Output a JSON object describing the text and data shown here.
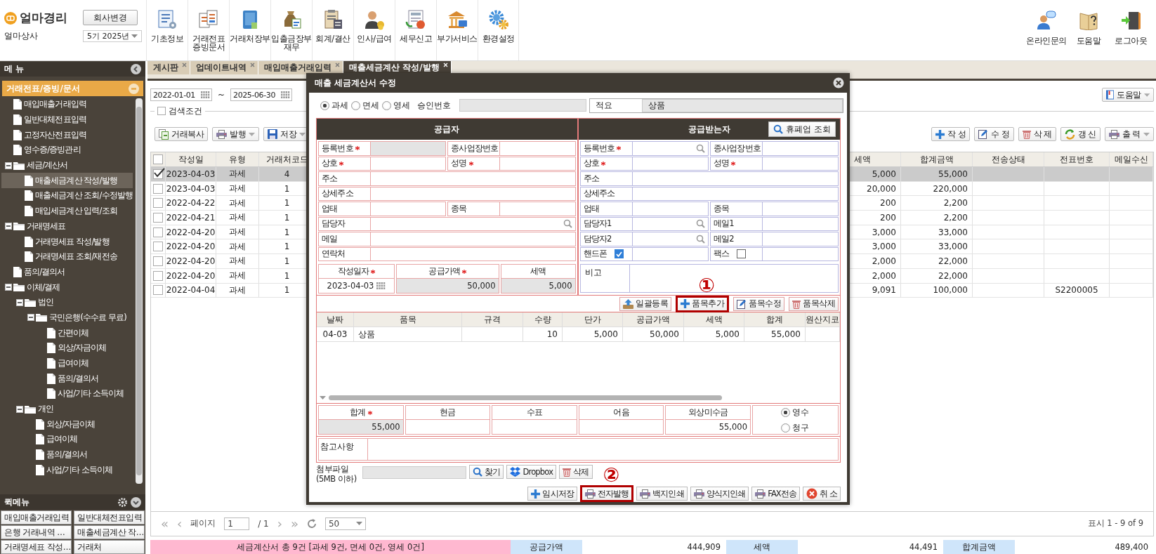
{
  "app": {
    "logo": "얼마경리",
    "company": "얼마상사",
    "change_company": "회사변경",
    "period": "5기 2025년"
  },
  "nav": [
    {
      "label": "기초정보"
    },
    {
      "label": "거래전표\n증빙문서"
    },
    {
      "label": "거래처장부"
    },
    {
      "label": "입출금장부\n재무"
    },
    {
      "label": "회계/결산"
    },
    {
      "label": "인사/급여"
    },
    {
      "label": "세무신고"
    },
    {
      "label": "부가서비스"
    },
    {
      "label": "환경설정"
    }
  ],
  "top_right": [
    {
      "label": "온라인문의"
    },
    {
      "label": "도움말"
    },
    {
      "label": "로그아웃"
    }
  ],
  "sidebar": {
    "title": "메 뉴",
    "group": "거래전표/증빙/문서",
    "tree": [
      {
        "label": "매입매출거래입력",
        "kind": "doc",
        "selected": false
      },
      {
        "label": "일반대체전표입력",
        "kind": "doc",
        "selected": false
      },
      {
        "label": "고정자산전표입력",
        "kind": "doc",
        "selected": false
      },
      {
        "label": "영수증/증빙관리",
        "kind": "doc",
        "selected": false
      },
      {
        "label": "세금/계산서",
        "kind": "folder",
        "expanded": true,
        "selected": false,
        "children": [
          {
            "label": "매출세금계산 작성/발행",
            "kind": "doc",
            "selected": true
          },
          {
            "label": "매출세금계산 조회/수정발행",
            "kind": "doc",
            "selected": false
          },
          {
            "label": "매입세금계산 입력/조회",
            "kind": "doc",
            "selected": false
          }
        ]
      },
      {
        "label": "거래명세표",
        "kind": "folder",
        "expanded": true,
        "selected": false,
        "children": [
          {
            "label": "거래명세표 작성/발행",
            "kind": "doc",
            "selected": false
          },
          {
            "label": "거래명세표 조회/재전송",
            "kind": "doc",
            "selected": false
          }
        ]
      },
      {
        "label": "품의/결의서",
        "kind": "doc",
        "selected": false
      },
      {
        "label": "이체/결제",
        "kind": "folder",
        "expanded": true,
        "selected": false,
        "children": [
          {
            "label": "법인",
            "kind": "folder",
            "expanded": true,
            "selected": false,
            "children": [
              {
                "label": "국민은행(수수료 무료)",
                "kind": "folder",
                "expanded": true,
                "selected": false,
                "children": [
                  {
                    "label": "간편이체",
                    "kind": "doc",
                    "selected": false
                  },
                  {
                    "label": "외상/자금이체",
                    "kind": "doc",
                    "selected": false
                  },
                  {
                    "label": "급여이체",
                    "kind": "doc",
                    "selected": false
                  },
                  {
                    "label": "품의/결의서",
                    "kind": "doc",
                    "selected": false
                  },
                  {
                    "label": "사업/기타 소득이체",
                    "kind": "doc",
                    "selected": false
                  }
                ]
              }
            ]
          },
          {
            "label": "개인",
            "kind": "folder",
            "expanded": true,
            "selected": false,
            "children": [
              {
                "label": "외상/자금이체",
                "kind": "doc",
                "selected": false
              },
              {
                "label": "급여이체",
                "kind": "doc",
                "selected": false
              },
              {
                "label": "품의/결의서",
                "kind": "doc",
                "selected": false
              },
              {
                "label": "사업/기타 소득이체",
                "kind": "doc",
                "selected": false
              }
            ]
          }
        ]
      }
    ]
  },
  "quick_menu": {
    "title": "퀵메뉴",
    "items": [
      "매입매출거래입력",
      "일반대체전표입력",
      "은행 거래내역 …",
      "매출세금계산 작…",
      "거래명세표 작성…",
      "거래처"
    ]
  },
  "tabs": [
    {
      "label": "게시판",
      "selected": false
    },
    {
      "label": "업데이트내역",
      "selected": false
    },
    {
      "label": "매입매출거래입력",
      "selected": false
    },
    {
      "label": "매출세금계산 작성/발행",
      "selected": true
    }
  ],
  "filter": {
    "date_from": "2022-01-01",
    "separator": "~",
    "date_to": "2025-06-30",
    "search_label": "검색조건",
    "search_checked": false,
    "help": "도움말"
  },
  "toolbar_left": [
    {
      "label": "거래복사",
      "kind": "copy",
      "dropdown": false
    },
    {
      "label": "발행",
      "kind": "print",
      "dropdown": true
    },
    {
      "label": "저장",
      "kind": "save",
      "dropdown": true
    }
  ],
  "toolbar_right": [
    {
      "label": "작 성",
      "kind": "add",
      "dropdown": false
    },
    {
      "label": "수 정",
      "kind": "edit",
      "dropdown": false
    },
    {
      "label": "삭 제",
      "kind": "delete",
      "dropdown": false
    },
    {
      "label": "갱 신",
      "kind": "refresh",
      "dropdown": false
    },
    {
      "label": "출 력",
      "kind": "print",
      "dropdown": true
    }
  ],
  "table": {
    "select_all": false,
    "columns": [
      "작성일",
      "유형",
      "거래처코드",
      "세액",
      "합계금액",
      "전송상태",
      "전표번호",
      "메일수신"
    ],
    "rows": [
      {
        "checked": true,
        "selected": true,
        "cells": [
          "2023-04-03",
          "과세",
          "4",
          "5,000",
          "55,000",
          "",
          "",
          ""
        ]
      },
      {
        "checked": false,
        "selected": false,
        "cells": [
          "2023-04-03",
          "과세",
          "1",
          "20,000",
          "220,000",
          "",
          "",
          ""
        ]
      },
      {
        "checked": false,
        "selected": false,
        "cells": [
          "2022-04-22",
          "과세",
          "1",
          "200",
          "2,200",
          "",
          "",
          ""
        ]
      },
      {
        "checked": false,
        "selected": false,
        "cells": [
          "2022-04-21",
          "과세",
          "1",
          "200",
          "2,200",
          "",
          "",
          ""
        ]
      },
      {
        "checked": false,
        "selected": false,
        "cells": [
          "2022-04-20",
          "과세",
          "1",
          "3,000",
          "33,000",
          "",
          "",
          ""
        ]
      },
      {
        "checked": false,
        "selected": false,
        "cells": [
          "2022-04-20",
          "과세",
          "1",
          "3,000",
          "33,000",
          "",
          "",
          ""
        ]
      },
      {
        "checked": false,
        "selected": false,
        "cells": [
          "2022-04-20",
          "과세",
          "1",
          "2,000",
          "22,000",
          "",
          "",
          ""
        ]
      },
      {
        "checked": false,
        "selected": false,
        "cells": [
          "2022-04-20",
          "과세",
          "1",
          "2,000",
          "22,000",
          "",
          "",
          ""
        ]
      },
      {
        "checked": false,
        "selected": false,
        "cells": [
          "2022-04-04",
          "과세",
          "1",
          "9,091",
          "100,000",
          "",
          "S2200005",
          ""
        ]
      }
    ]
  },
  "pager": {
    "first": "«",
    "prev": "‹",
    "page_label": "페이지",
    "page": "1",
    "of": "/ 1",
    "next": "›",
    "last": "»",
    "page_size": "50",
    "summary": "표시 1 - 9 of 9"
  },
  "summary_bar": {
    "count": "세금계산서 총 9건 [과세 9건, 면세 0건, 영세 0건]",
    "totals": [
      {
        "label": "공급가액",
        "value": "444,909"
      },
      {
        "label": "세액",
        "value": "44,491"
      },
      {
        "label": "합계금액",
        "value": "489,400"
      }
    ]
  },
  "dialog": {
    "title": "매출 세금계산서 수정",
    "tax_types": [
      {
        "label": "과세",
        "selected": true
      },
      {
        "label": "면세",
        "selected": false
      },
      {
        "label": "영세",
        "selected": false
      }
    ],
    "approval_label": "승인번호",
    "summary_label": "적요",
    "summary_value": "상품",
    "supplier": {
      "title": "공급자",
      "rows": [
        [
          {
            "label": "등록번호",
            "required": true,
            "kind": "readonly"
          },
          {
            "label": "종사업장번호",
            "required": false,
            "kind": "text"
          }
        ],
        [
          {
            "label": "상호",
            "required": true,
            "kind": "text"
          },
          {
            "label": "성명",
            "required": true,
            "kind": "text"
          }
        ],
        [
          {
            "label": "주소",
            "required": false,
            "kind": "text"
          }
        ],
        [
          {
            "label": "상세주소",
            "required": false,
            "kind": "text"
          }
        ],
        [
          {
            "label": "업태",
            "required": false,
            "kind": "text"
          },
          {
            "label": "종목",
            "required": false,
            "kind": "text"
          }
        ],
        [
          {
            "label": "담당자",
            "required": false,
            "kind": "search"
          }
        ],
        [
          {
            "label": "메일",
            "required": false,
            "kind": "text"
          }
        ],
        [
          {
            "label": "연락처",
            "required": false,
            "kind": "text"
          }
        ]
      ],
      "amounts": [
        {
          "label": "작성일자",
          "required": true,
          "kind": "date",
          "value": "2023-04-03"
        },
        {
          "label": "공급가액",
          "required": true,
          "kind": "readonly",
          "value": "50,000"
        },
        {
          "label": "세액",
          "required": false,
          "kind": "readonly",
          "value": "5,000"
        }
      ]
    },
    "buyer": {
      "title": "공급받는자",
      "lookup": "휴폐업 조회",
      "rows": [
        [
          {
            "label": "등록번호",
            "required": true,
            "kind": "search"
          },
          {
            "label": "종사업장번호",
            "required": false,
            "kind": "text"
          }
        ],
        [
          {
            "label": "상호",
            "required": true,
            "kind": "text"
          },
          {
            "label": "성명",
            "required": true,
            "kind": "text"
          }
        ],
        [
          {
            "label": "주소",
            "required": false,
            "kind": "text"
          }
        ],
        [
          {
            "label": "상세주소",
            "required": false,
            "kind": "text"
          }
        ],
        [
          {
            "label": "업태",
            "required": false,
            "kind": "text"
          },
          {
            "label": "종목",
            "required": false,
            "kind": "text"
          }
        ],
        [
          {
            "label": "담당자1",
            "required": false,
            "kind": "search"
          },
          {
            "label": "메일1",
            "required": false,
            "kind": "text"
          }
        ],
        [
          {
            "label": "담당자2",
            "required": false,
            "kind": "search"
          },
          {
            "label": "메일2",
            "required": false,
            "kind": "text"
          }
        ],
        [
          {
            "label": "핸드폰",
            "required": false,
            "kind": "check",
            "checked": true
          },
          {
            "label": "팩스",
            "required": false,
            "kind": "check",
            "checked": false
          }
        ]
      ],
      "note_label": "비고"
    },
    "item_buttons": [
      {
        "label": "일괄등록",
        "kind": "upload",
        "highlighted": false
      },
      {
        "label": "품목추가",
        "kind": "add",
        "highlighted": true,
        "marker": "①"
      },
      {
        "label": "품목수정",
        "kind": "edit",
        "highlighted": false
      },
      {
        "label": "품목삭제",
        "kind": "delete",
        "highlighted": false
      }
    ],
    "items": {
      "columns": [
        "날짜",
        "품목",
        "규격",
        "수량",
        "단가",
        "공급가액",
        "세액",
        "합계",
        "원산지코"
      ],
      "rows": [
        [
          "04-03",
          "상품",
          "",
          "10",
          "5,000",
          "50,000",
          "5,000",
          "55,000",
          ""
        ]
      ]
    },
    "totals": [
      {
        "label": "합계",
        "required": true,
        "kind": "readonly",
        "value": "55,000"
      },
      {
        "label": "현금",
        "required": false,
        "kind": "text"
      },
      {
        "label": "수표",
        "required": false,
        "kind": "text"
      },
      {
        "label": "어음",
        "required": false,
        "kind": "text"
      },
      {
        "label": "외상미수금",
        "required": false,
        "kind": "text",
        "value": "55,000"
      }
    ],
    "receipt": [
      {
        "label": "영수",
        "selected": true
      },
      {
        "label": "청구",
        "selected": false
      }
    ],
    "remarks_label": "참고사항",
    "attachment": {
      "label": "첨부파일",
      "note": "(5MB 이하)",
      "buttons": [
        {
          "label": "찾기",
          "kind": "search"
        },
        {
          "label": "Dropbox",
          "kind": "dropbox"
        },
        {
          "label": "삭제",
          "kind": "delete"
        }
      ]
    },
    "actions": [
      {
        "label": "임시저장",
        "kind": "add",
        "highlighted": false
      },
      {
        "label": "전자발행",
        "kind": "print",
        "highlighted": true,
        "marker": "②"
      },
      {
        "label": "백지인쇄",
        "kind": "print",
        "highlighted": false
      },
      {
        "label": "양식지인쇄",
        "kind": "print",
        "highlighted": false
      },
      {
        "label": "FAX전송",
        "kind": "print",
        "highlighted": false
      },
      {
        "label": "취 소",
        "kind": "cancel",
        "highlighted": false
      }
    ]
  }
}
